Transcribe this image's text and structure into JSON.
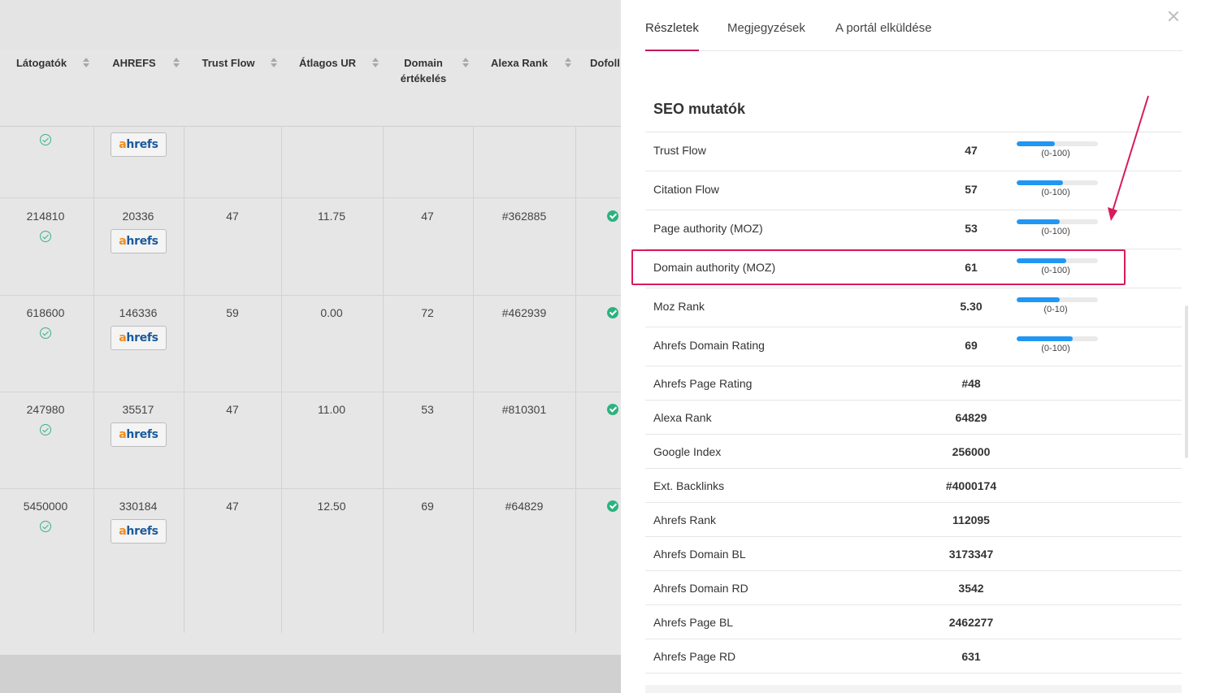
{
  "table": {
    "headers": [
      "Látogatók",
      "AHREFS",
      "Trust Flow",
      "Átlagos UR",
      "Domain",
      "értékelés",
      "Alexa Rank",
      "Dofoll"
    ],
    "ahrefs_label_a": "a",
    "ahrefs_label_rest": "hrefs",
    "rows": [
      {
        "visitors": "",
        "ahrefs": "",
        "trust_flow": "",
        "avg_ur": "",
        "domain_rating": "",
        "alexa": "",
        "dofollow": false
      },
      {
        "visitors": "214810",
        "ahrefs": "20336",
        "trust_flow": "47",
        "avg_ur": "11.75",
        "domain_rating": "47",
        "alexa": "#362885",
        "dofollow": true
      },
      {
        "visitors": "618600",
        "ahrefs": "146336",
        "trust_flow": "59",
        "avg_ur": "0.00",
        "domain_rating": "72",
        "alexa": "#462939",
        "dofollow": true
      },
      {
        "visitors": "247980",
        "ahrefs": "35517",
        "trust_flow": "47",
        "avg_ur": "11.00",
        "domain_rating": "53",
        "alexa": "#810301",
        "dofollow": true
      },
      {
        "visitors": "5450000",
        "ahrefs": "330184",
        "trust_flow": "47",
        "avg_ur": "12.50",
        "domain_rating": "69",
        "alexa": "#64829",
        "dofollow": true
      }
    ]
  },
  "panel": {
    "tabs": [
      "Részletek",
      "Megjegyzések",
      "A portál elküldése"
    ],
    "active_tab": 0,
    "section_title": "SEO mutatók",
    "metrics": [
      {
        "label": "Trust Flow",
        "value": "47",
        "range": "(0-100)",
        "fill": 0.47
      },
      {
        "label": "Citation Flow",
        "value": "57",
        "range": "(0-100)",
        "fill": 0.57
      },
      {
        "label": "Page authority (MOZ)",
        "value": "53",
        "range": "(0-100)",
        "fill": 0.53
      },
      {
        "label": "Domain authority (MOZ)",
        "value": "61",
        "range": "(0-100)",
        "fill": 0.61
      },
      {
        "label": "Moz Rank",
        "value": "5.30",
        "range": "(0-10)",
        "fill": 0.53
      },
      {
        "label": "Ahrefs Domain Rating",
        "value": "69",
        "range": "(0-100)",
        "fill": 0.69
      },
      {
        "label": "Ahrefs Page Rating",
        "value": "#48"
      },
      {
        "label": "Alexa Rank",
        "value": "64829"
      },
      {
        "label": "Google Index",
        "value": "256000"
      },
      {
        "label": "Ext. Backlinks",
        "value": "#4000174"
      },
      {
        "label": "Ahrefs Rank",
        "value": "112095"
      },
      {
        "label": "Ahrefs Domain BL",
        "value": "3173347"
      },
      {
        "label": "Ahrefs Domain RD",
        "value": "3542"
      },
      {
        "label": "Ahrefs Page BL",
        "value": "2462277"
      },
      {
        "label": "Ahrefs Page RD",
        "value": "631"
      }
    ],
    "highlighted_metric": "Domain authority (MOZ)"
  },
  "colors": {
    "accent": "#c2185b",
    "highlight": "#d81b5a",
    "bar": "#2196f3",
    "check": "#2bb37f"
  }
}
